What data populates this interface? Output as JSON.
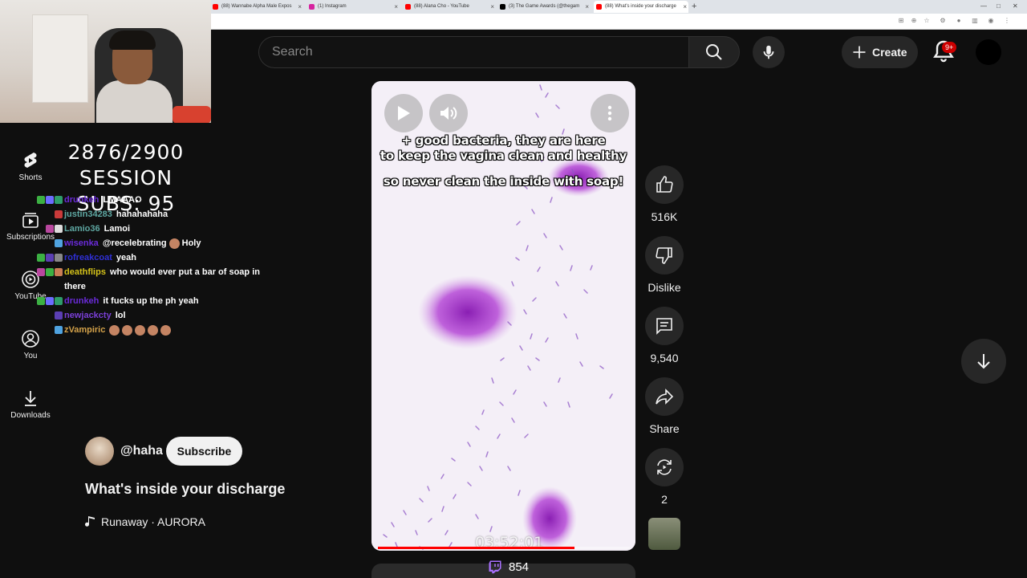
{
  "browser": {
    "tabs": [
      {
        "title": "(88) Wannabe Alpha Male Expos",
        "favicon_color": "#ff0000"
      },
      {
        "title": "(1) Instagram",
        "favicon_color": "#d6249f"
      },
      {
        "title": "(88) Alana Cho - YouTube",
        "favicon_color": "#ff0000"
      },
      {
        "title": "(3) The Game Awards (@thegam",
        "favicon_color": "#000000"
      },
      {
        "title": "(88) What's inside your discharge",
        "favicon_color": "#ff0000"
      }
    ],
    "new_tab_symbol": "+"
  },
  "overlay": {
    "subs_progress": "2876/2900",
    "session_subs": "SESSION SUBS: 95"
  },
  "guide": [
    {
      "label": "Shorts",
      "icon": "shorts-icon"
    },
    {
      "label": "Subscriptions",
      "icon": "subscriptions-icon"
    },
    {
      "label": "YouTube",
      "icon": "youtube-music-icon"
    },
    {
      "label": "You",
      "icon": "you-icon"
    },
    {
      "label": "Downloads",
      "icon": "download-icon"
    }
  ],
  "chat": [
    {
      "user": "drunkeh",
      "color": "#6a2bd9",
      "message": "LMAAAO",
      "badges": [
        "#3cb043",
        "#6c6cff",
        "#2e9c6a"
      ],
      "emotes": 0
    },
    {
      "user": "justin34283",
      "color": "#5fa8a3",
      "message": "hahahahaha",
      "badges": [
        "#c93a3a"
      ],
      "emotes": 0
    },
    {
      "user": "Lamio36",
      "color": "#5fa8a3",
      "message": "Lamoi",
      "badges": [
        "#b8479e",
        "#dddddd"
      ],
      "emotes": 0
    },
    {
      "user": "wisenka",
      "color": "#6a2bd9",
      "message": "@recelebrating",
      "badges": [
        "#4fa3e0"
      ],
      "emotes": 1,
      "after": "Holy"
    },
    {
      "user": "rofreakcoat",
      "color": "#2f2fd6",
      "message": "yeah",
      "badges": [
        "#3cb043",
        "#5b3fb3",
        "#888888"
      ],
      "emotes": 0
    },
    {
      "user": "deathflips",
      "color": "#d4c21a",
      "message": "who would ever put a bar of soap in there",
      "badges": [
        "#b8479e",
        "#3cb043",
        "#c97d56"
      ],
      "emotes": 0
    },
    {
      "user": "drunkeh",
      "color": "#6a2bd9",
      "message": "it fucks up the ph yeah",
      "badges": [
        "#3cb043",
        "#6c6cff",
        "#2e9c6a"
      ],
      "emotes": 0
    },
    {
      "user": "newjackcty",
      "color": "#7a3fd6",
      "message": "lol",
      "badges": [
        "#5b3fb3"
      ],
      "emotes": 0
    },
    {
      "user": "zVampiric",
      "color": "#d4a24a",
      "message": "",
      "badges": [
        "#4fa3e0"
      ],
      "emotes": 5
    }
  ],
  "header": {
    "search_placeholder": "Search",
    "create_label": "Create",
    "notification_count": "9+"
  },
  "video": {
    "caption_line1": "+ good bacteria, they are here",
    "caption_line2": "to keep the vagina clean and healthy",
    "caption_line3": "so never clean the inside with soap!",
    "timestamp": "03:52:01",
    "progress_fraction": 0.78,
    "viewer_count": "854"
  },
  "actions": {
    "likes": "516K",
    "dislike_label": "Dislike",
    "comments": "9,540",
    "share_label": "Share",
    "remix_count": "2"
  },
  "meta": {
    "channel": "@haha",
    "subscribe_label": "Subscribe",
    "title": "What's inside your discharge",
    "music": "Runaway · AURORA"
  },
  "colors": {
    "background": "#0f0f0f",
    "accent_red": "#ff0000",
    "surface": "#272727"
  }
}
